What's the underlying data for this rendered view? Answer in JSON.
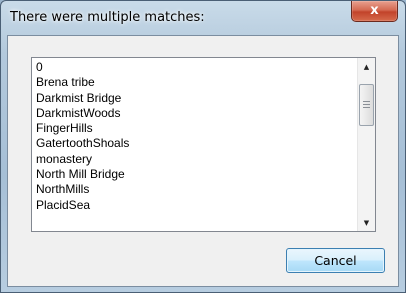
{
  "dialog": {
    "title": "There were multiple matches:",
    "close_symbol": "x"
  },
  "list": {
    "items": [
      "0",
      "Brena tribe",
      "Darkmist Bridge",
      "DarkmistWoods",
      "FingerHills",
      "GatertoothShoals",
      "monastery",
      "North Mill Bridge",
      "NorthMills",
      "PlacidSea"
    ]
  },
  "scrollbar": {
    "up_icon": "▲",
    "down_icon": "▼"
  },
  "buttons": {
    "cancel_label": "Cancel"
  }
}
